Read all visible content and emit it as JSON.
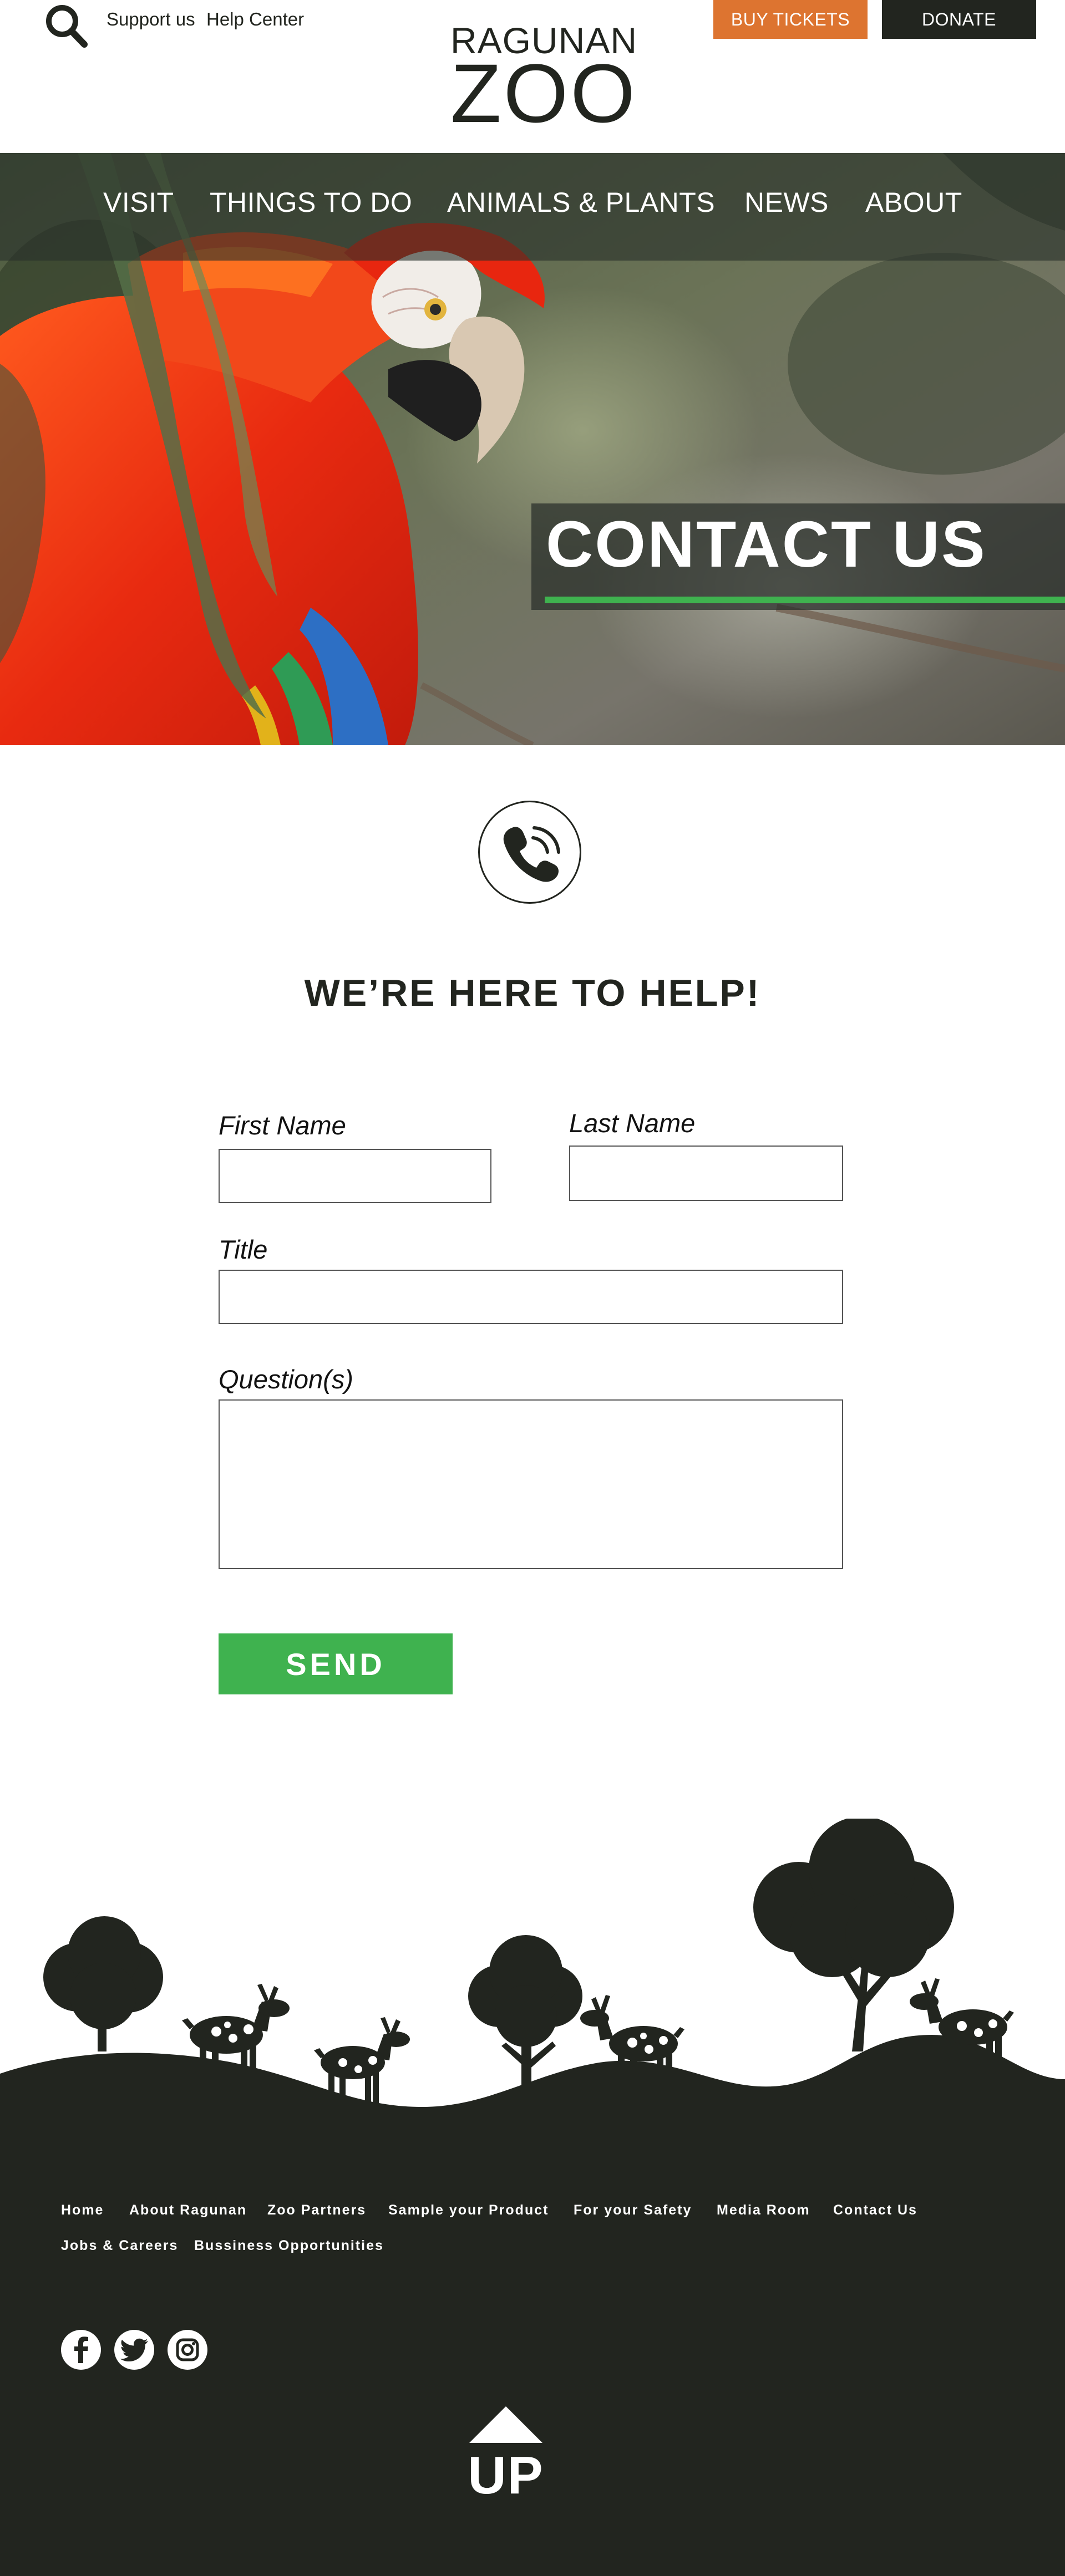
{
  "header": {
    "support_label": "Support us",
    "help_label": "Help Center",
    "logo_top": "RAGUNAN",
    "logo_main": "ZOO",
    "buy_tickets_label": "BUY TICKETS",
    "donate_label": "DONATE",
    "search_icon": "search-icon"
  },
  "nav": {
    "items": [
      "VISIT",
      "THINGS TO DO",
      "ANIMALS & PLANTS",
      "NEWS",
      "ABOUT"
    ]
  },
  "hero": {
    "title": "CONTACT US"
  },
  "help": {
    "icon": "phone-icon",
    "heading": "WE’RE HERE TO HELP!"
  },
  "form": {
    "first_name_label": "First Name",
    "last_name_label": "Last Name",
    "title_label": "Title",
    "questions_label": "Question(s)",
    "first_name_value": "",
    "last_name_value": "",
    "title_value": "",
    "questions_value": "",
    "send_label": "SEND"
  },
  "footer": {
    "links_row1": [
      "Home",
      "About Ragunan",
      "Zoo Partners",
      "Sample your Product",
      "For your Safety",
      "Media Room",
      "Contact Us"
    ],
    "links_row2": [
      "Jobs & Careers",
      "Bussiness Opportunities"
    ],
    "social_icons": [
      "facebook-icon",
      "twitter-icon",
      "instagram-icon"
    ],
    "up_label": "UP"
  },
  "colors": {
    "accent_orange": "#dd7430",
    "accent_green": "#3fb24f",
    "dark": "#22251f",
    "white": "#ffffff"
  }
}
